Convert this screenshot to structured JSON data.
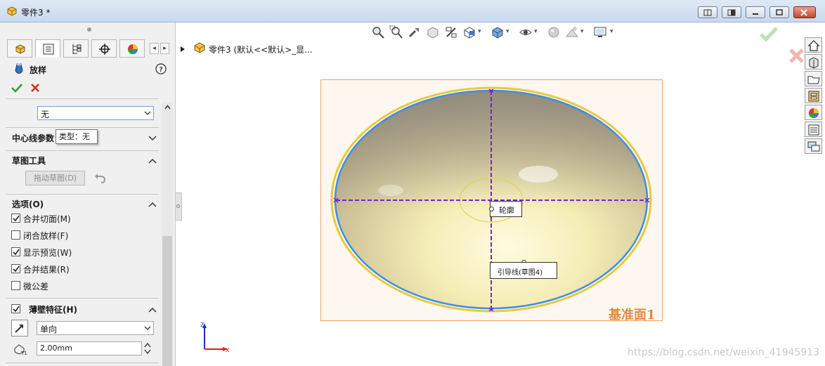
{
  "window": {
    "title": "零件3 *",
    "app_icon": "part-icon"
  },
  "panel": {
    "tabs": [
      {
        "icon": "feature-manager-icon"
      },
      {
        "icon": "property-manager-icon"
      },
      {
        "icon": "configuration-manager-icon"
      },
      {
        "icon": "dimxpert-icon"
      },
      {
        "icon": "display-manager-icon"
      }
    ],
    "feature_title": "放样",
    "start_end_constraint_value": "无",
    "tooltip": "类型：无",
    "centerline_section": "中心线参数",
    "sketch_tools_section": "草图工具",
    "drag_sketch_button": "拖动草图(D)",
    "options_section": "选项(O)",
    "options": [
      {
        "label": "合并切面(M)",
        "checked": true
      },
      {
        "label": "闭合放样(F)",
        "checked": false
      },
      {
        "label": "显示预览(W)",
        "checked": true
      },
      {
        "label": "合并结果(R)",
        "checked": true
      },
      {
        "label": "微公差",
        "checked": false
      }
    ],
    "thin_feature_section": "薄壁特征(H)",
    "thin_feature_checked": true,
    "thin_direction_value": "单向",
    "thickness_value": "2.00mm"
  },
  "viewport": {
    "tree_label": "零件3  (默认<<默认>_显...",
    "callout_outline": "轮廓",
    "callout_guide": "引导线(草图4)",
    "plane_label": "基准面1",
    "triad_x": "X",
    "triad_z": "Z",
    "watermark": "https://blog.csdn.net/weixin_41945913"
  },
  "colors": {
    "accent_blue": "#3b8fe6",
    "sketch_purple": "#7a1fd8",
    "plane_border": "#f2a35b",
    "plane_fill": "#fdf7f0",
    "ok_green": "#2fa32f",
    "cancel_red": "#d22b1f"
  }
}
